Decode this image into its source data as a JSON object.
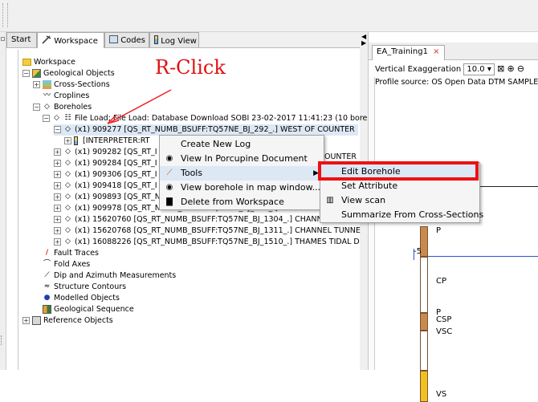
{
  "tabs": [
    {
      "label": "Start",
      "icon": "none"
    },
    {
      "label": "Workspace",
      "icon": "pick-icon"
    },
    {
      "label": "Codes",
      "icon": "codes-icon"
    },
    {
      "label": "Log View",
      "icon": "log-icon"
    }
  ],
  "tree": {
    "workspace": "Workspace",
    "geological_objects": "Geological Objects",
    "cross_sections": "Cross-Sections",
    "croplines": "Croplines",
    "boreholes": "Boreholes",
    "file_load": "File Load; File Load: Database Download SOBI 23-02-2017 11:41:23 (10 bore",
    "bh1": "(x1) 909277 [QS_RT_NUMB_BSUFF:TQ57NE_BJ_292_.] WEST OF COUNTER",
    "interpreter": "[INTERPRETER:RT",
    "bh2": "(x1) 909282 [QS_RT_I",
    "bh3": "(x1) 909284 [QS_RT_I",
    "bh4": "(x1) 909306 [QS_RT_I",
    "bh5": "(x1) 909418 [QS_RT_I",
    "bh6": "(x1) 909893 [QS_RT_NUMB_BSUFF:TQ57NE_BJ_909_.] LONDON W",
    "bh7": "(x1) 909978 [QS_RT_NUMB_BSUFF:TQ57NE_BJ_994_.] DARTFORD",
    "bh8": "(x1) 15620760 [QS_RT_NUMB_BSUFF:TQ57NE_BJ_1304_.] CHANNEL TUNNE",
    "bh9": "(x1) 15620768 [QS_RT_NUMB_BSUFF:TQ57NE_BJ_1311_.] CHANNEL TUNNE",
    "bh10": "(x1) 16088226 [QS_RT_NUMB_BSUFF:TQ57NE_BJ_1510_.] THAMES TIDAL D",
    "fault_traces": "Fault Traces",
    "fold_axes": "Fold Axes",
    "dip_azimuth": "Dip and Azimuth Measurements",
    "structure_contours": "Structure Contours",
    "modelled_objects": "Modelled Objects",
    "geological_sequence": "Geological Sequence",
    "reference_objects": "Reference Objects"
  },
  "annotation": {
    "text": "R-Click",
    "color": "#e01010"
  },
  "context_menu": {
    "items": [
      {
        "label": "Create New Log",
        "icon": "none"
      },
      {
        "label": "View In Porcupine Document",
        "icon": "eye-icon"
      },
      {
        "label": "Tools",
        "icon": "pick-icon"
      },
      {
        "label": "View borehole in map window...",
        "icon": "eye-icon"
      },
      {
        "label": "Delete from Workspace",
        "icon": "trash-icon"
      }
    ],
    "right_peek": "OUNTER"
  },
  "submenu": {
    "items": [
      {
        "label": "Edit Borehole"
      },
      {
        "label": "Set Attribute"
      },
      {
        "label": "View scan"
      },
      {
        "label": "Summarize From Cross-Sections"
      }
    ]
  },
  "right_panel": {
    "doc_tab": "EA_Training1",
    "vertical_exaggeration_label": "Vertical Exaggeration",
    "vertical_exaggeration_value": "10.0",
    "profile_source": "Profile source: OS Open Data DTM SAMPLE.ob",
    "log_labels": [
      "P",
      "-5",
      "CP",
      "P",
      "CSP",
      "VSC",
      "VS"
    ]
  },
  "colors": {
    "highlight_box": "#ee1111",
    "accent_arrow": "#ee2222"
  }
}
